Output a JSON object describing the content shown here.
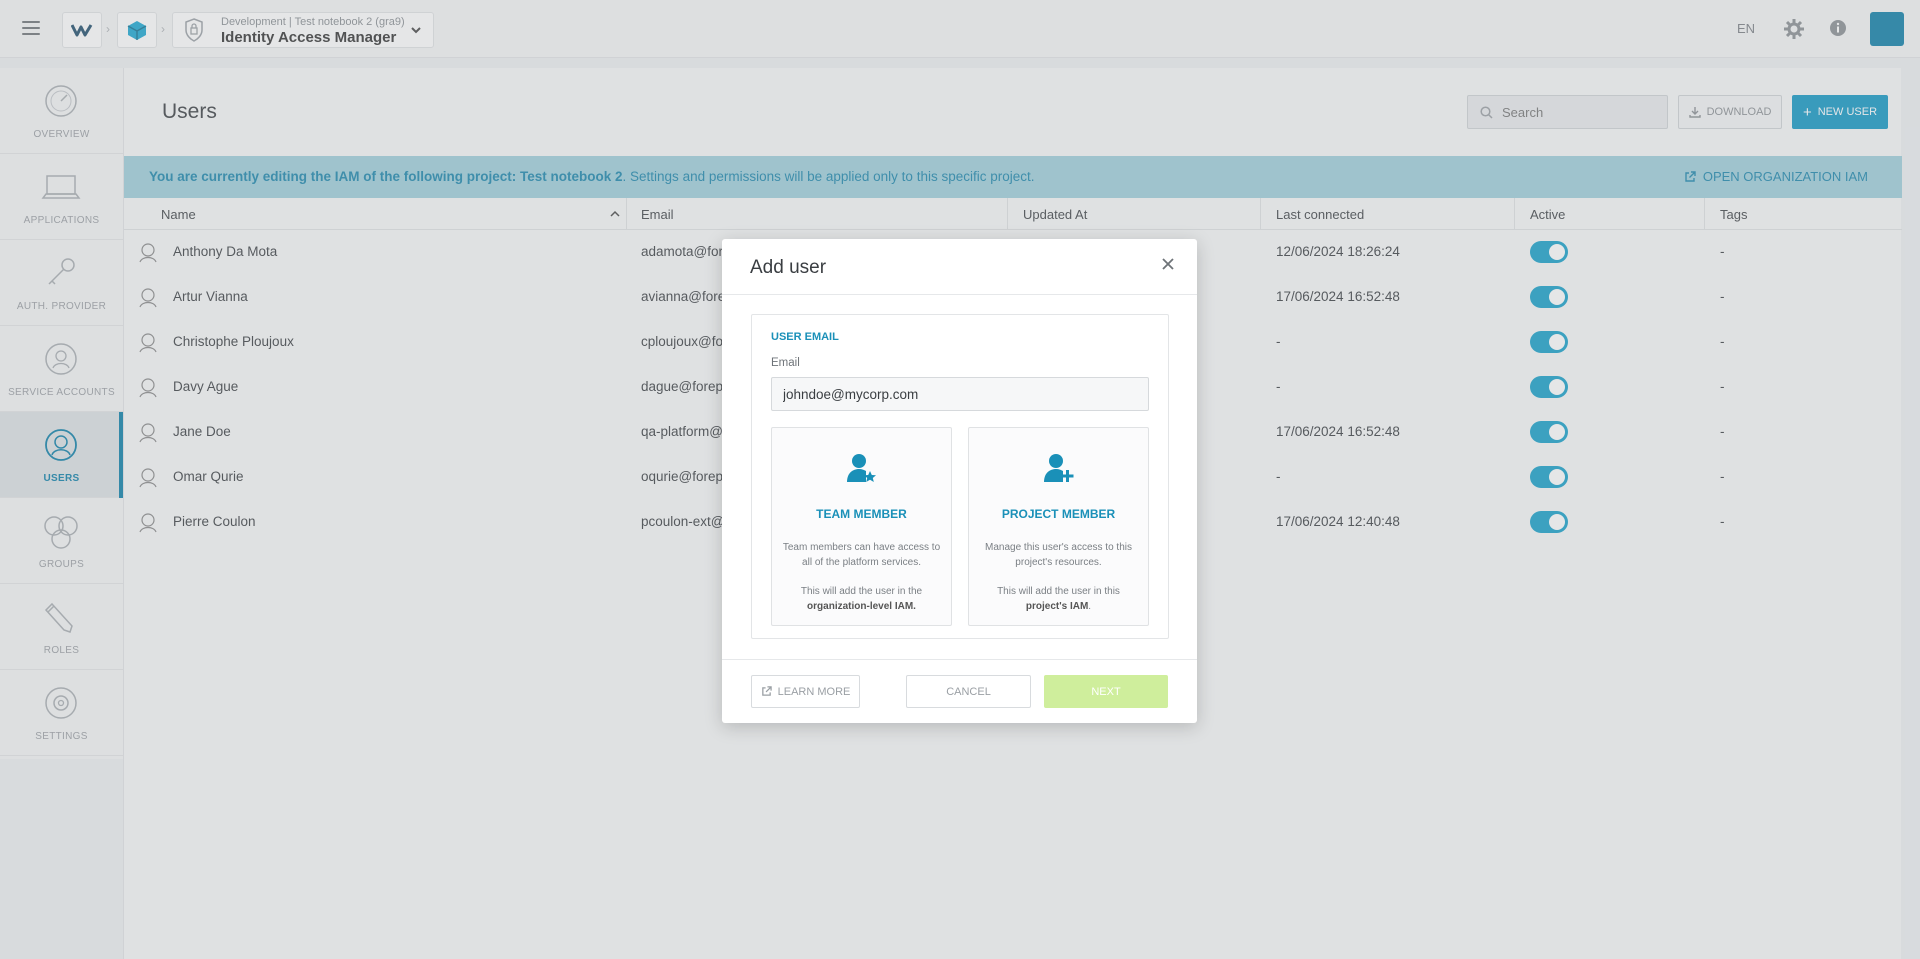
{
  "topbar": {
    "breadcrumb_sub": "Development | Test notebook 2 (gra9)",
    "breadcrumb_title": "Identity Access Manager",
    "language": "EN"
  },
  "sidebar": {
    "items": [
      {
        "label": "OVERVIEW",
        "icon": "gauge-icon",
        "active": false
      },
      {
        "label": "APPLICATIONS",
        "icon": "laptop-icon",
        "active": false
      },
      {
        "label": "AUTH. PROVIDER",
        "icon": "key-icon",
        "active": false
      },
      {
        "label": "SERVICE ACCOUNTS",
        "icon": "service-account-icon",
        "active": false
      },
      {
        "label": "USERS",
        "icon": "user-face-icon",
        "active": true
      },
      {
        "label": "GROUPS",
        "icon": "group-icon",
        "active": false
      },
      {
        "label": "ROLES",
        "icon": "pencil-icon",
        "active": false
      },
      {
        "label": "SETTINGS",
        "icon": "gear-icon",
        "active": false
      }
    ]
  },
  "main": {
    "title": "Users",
    "search_placeholder": "Search",
    "download_label": "DOWNLOAD",
    "new_user_label": "NEW USER",
    "notice_bold": "You are currently editing the IAM of the following project: Test notebook 2",
    "notice_rest": ". Settings and permissions will be applied only to this specific project.",
    "open_org_iam_label": "OPEN ORGANIZATION IAM",
    "columns": [
      "Name",
      "Email",
      "Updated At",
      "Last connected",
      "Active",
      "Tags"
    ],
    "rows": [
      {
        "name": "Anthony Da Mota",
        "email": "adamota@fore",
        "last": "12/06/2024 18:26:24",
        "tags": "-"
      },
      {
        "name": "Artur Vianna",
        "email": "avianna@fore",
        "last": "17/06/2024 16:52:48",
        "tags": "-"
      },
      {
        "name": "Christophe Ploujoux",
        "email": "cploujoux@fo",
        "last": "-",
        "tags": "-"
      },
      {
        "name": "Davy Ague",
        "email": "dague@forep",
        "last": "-",
        "tags": "-"
      },
      {
        "name": "Jane Doe",
        "email": "qa-platform@",
        "last": "17/06/2024 16:52:48",
        "tags": "-"
      },
      {
        "name": "Omar Qurie",
        "email": "oqurie@forep",
        "last": "-",
        "tags": "-"
      },
      {
        "name": "Pierre Coulon",
        "email": "pcoulon-ext@",
        "last": "17/06/2024 12:40:48",
        "tags": "-"
      }
    ]
  },
  "modal": {
    "title": "Add user",
    "section_title": "USER EMAIL",
    "email_label": "Email",
    "email_value": "johndoe@mycorp.com",
    "team_card": {
      "title": "TEAM MEMBER",
      "desc": "Team members can have access to all of the platform services.",
      "note_prefix": "This will add the user in the ",
      "note_bold": "organization-level IAM."
    },
    "project_card": {
      "title": "PROJECT MEMBER",
      "desc": "Manage this user's access to this project's resources.",
      "note_prefix": "This will add the user in this ",
      "note_bold": "project's IAM",
      "note_suffix": "."
    },
    "learn_more_label": "LEARN MORE",
    "cancel_label": "CANCEL",
    "next_label": "NEXT"
  },
  "colors": {
    "accent": "#1197c4",
    "notice_bg": "#9fcfdc",
    "next_disabled": "#cfee9c"
  }
}
